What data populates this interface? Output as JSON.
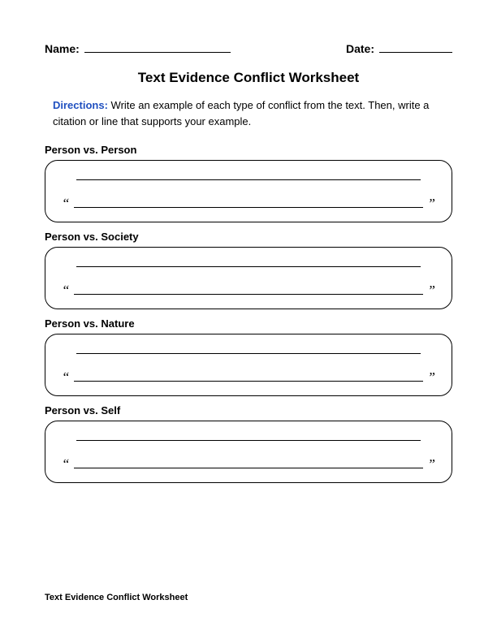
{
  "header": {
    "name_label": "Name:",
    "date_label": "Date:"
  },
  "title": "Text Evidence Conflict Worksheet",
  "directions": {
    "label": "Directions:",
    "text": "Write an example of each type of conflict from the text. Then, write a citation or line that supports your example."
  },
  "sections": [
    {
      "label": "Person vs. Person"
    },
    {
      "label": "Person vs. Society"
    },
    {
      "label": "Person vs. Nature"
    },
    {
      "label": "Person vs. Self"
    }
  ],
  "quote_open": "“",
  "quote_close": "”",
  "footer": "Text Evidence Conflict Worksheet"
}
